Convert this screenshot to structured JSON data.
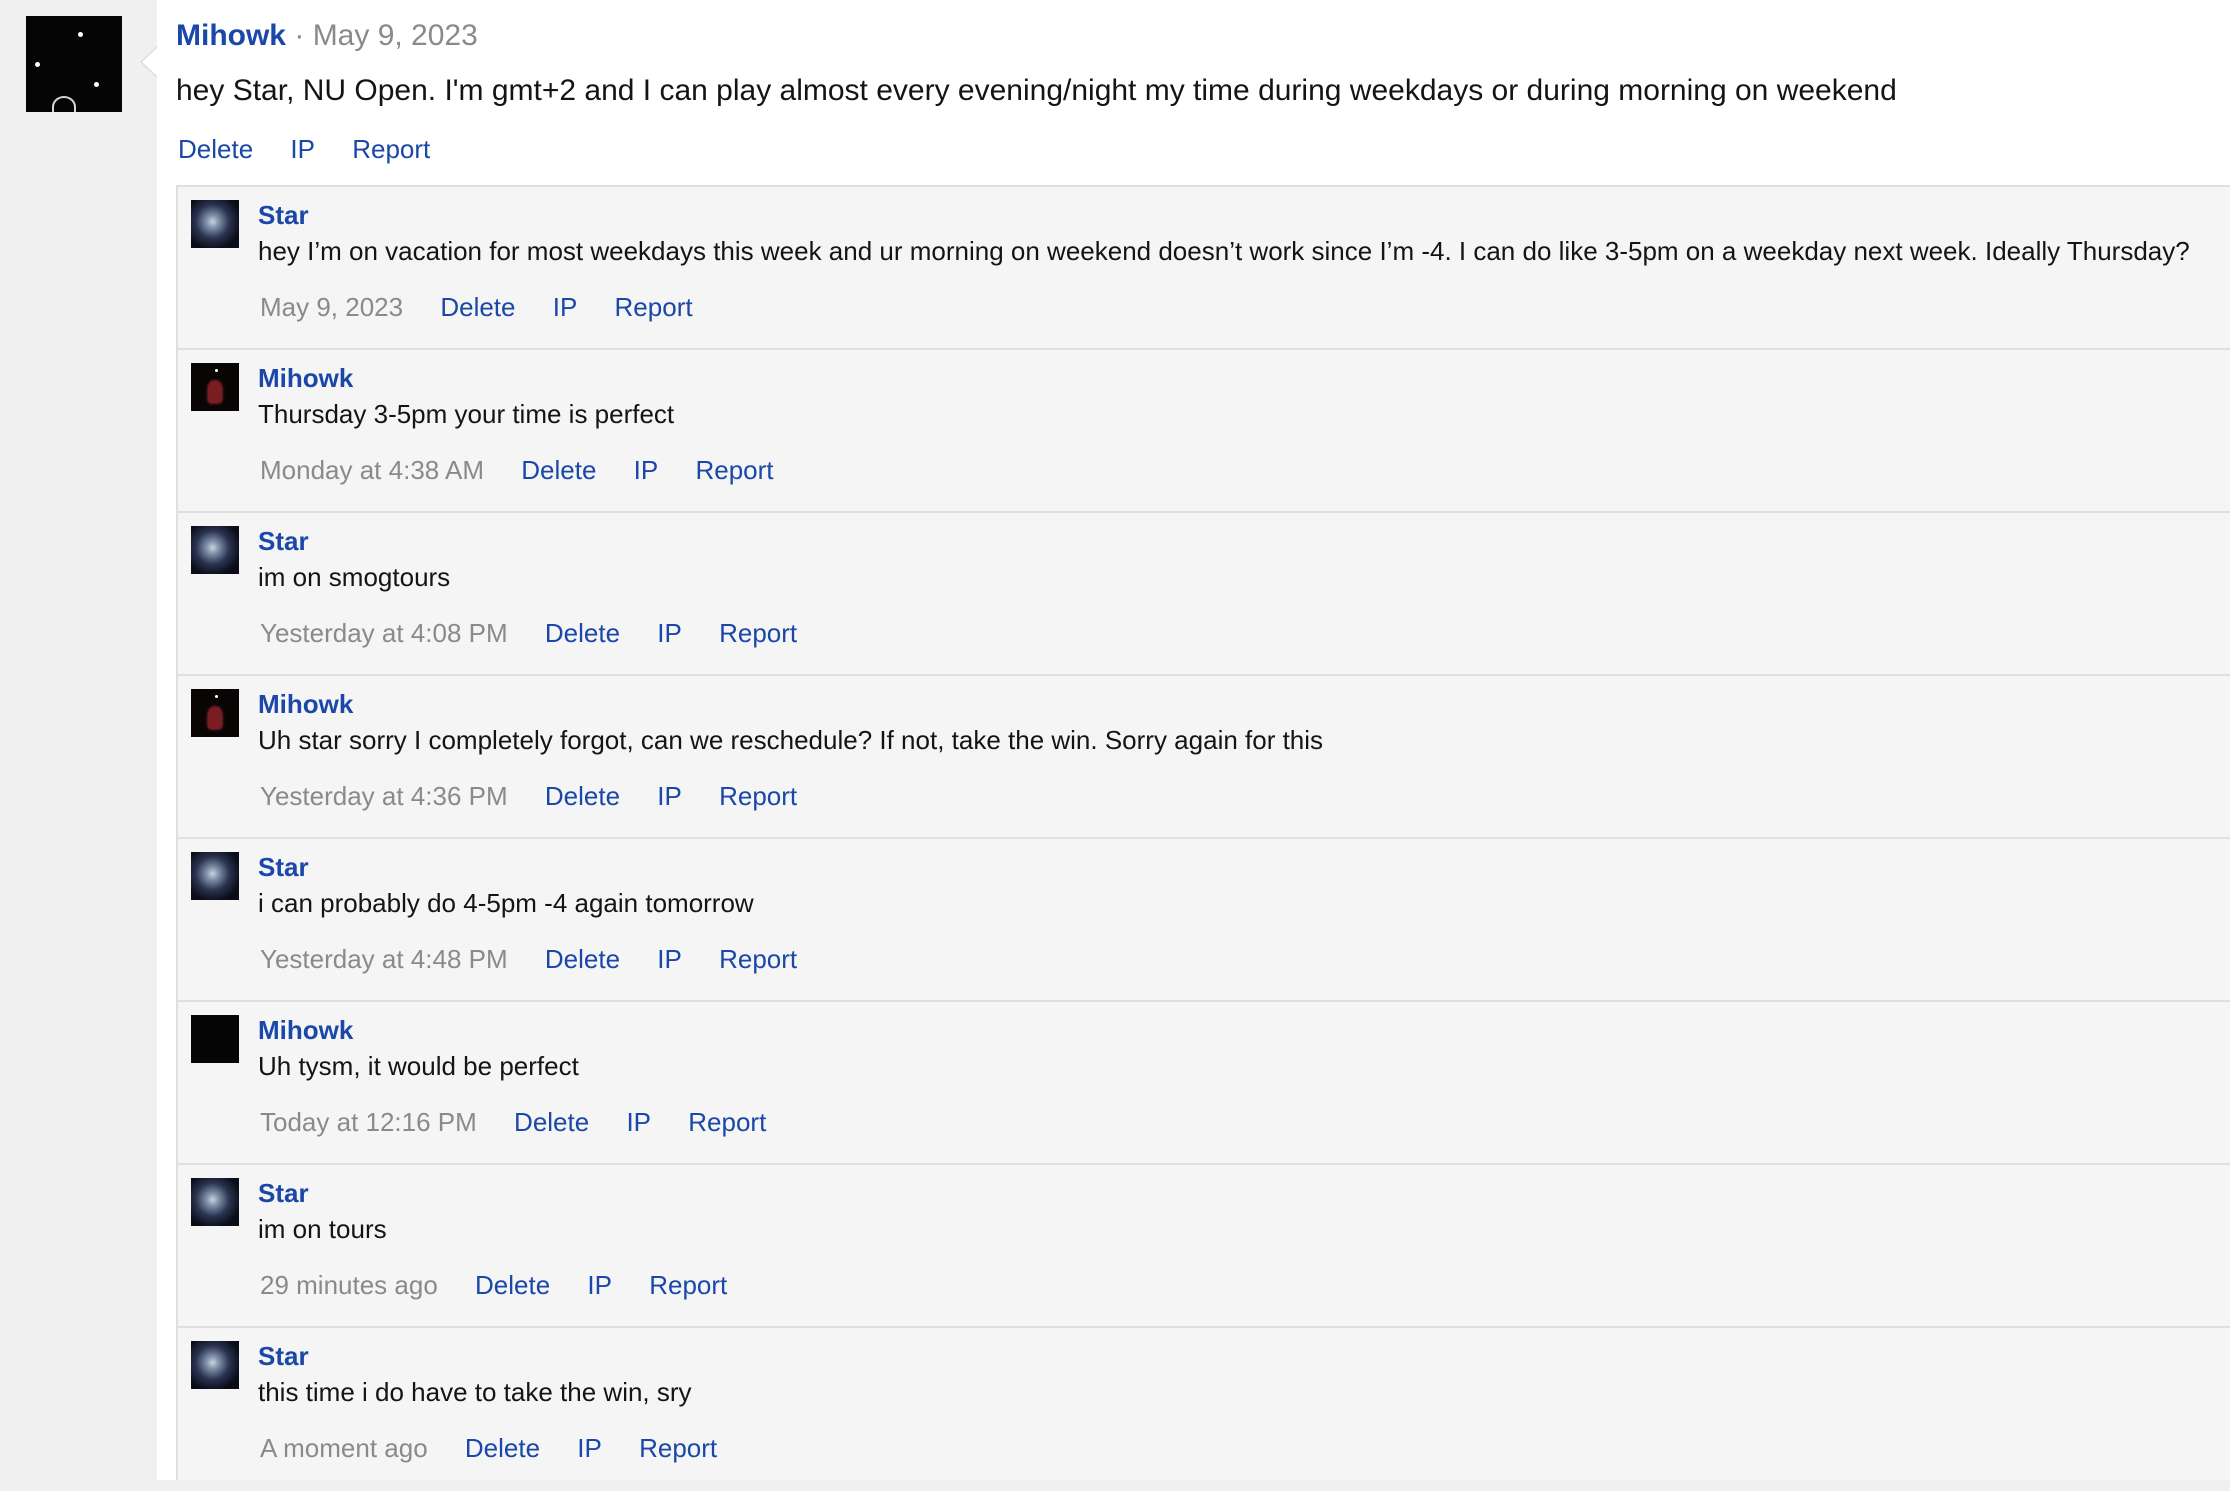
{
  "post": {
    "username": "Mihowk",
    "separator": "·",
    "date": "May 9, 2023",
    "body": "hey Star, NU Open. I'm gmt+2 and I can play almost every evening/night my time during weekdays or during morning on weekend",
    "actions": {
      "delete": "Delete",
      "ip": "IP",
      "report": "Report"
    }
  },
  "comments": [
    {
      "username": "Star",
      "avatar": "star",
      "text": "hey I’m on vacation for most weekdays this week and ur morning on weekend doesn’t work since I’m -4. I can do like 3-5pm on a weekday next week. Ideally Thursday?",
      "time": "May 9, 2023",
      "delete": "Delete",
      "ip": "IP",
      "report": "Report"
    },
    {
      "username": "Mihowk",
      "avatar": "mihowk",
      "text": "Thursday 3-5pm your time is perfect",
      "time": "Monday at 4:38 AM",
      "delete": "Delete",
      "ip": "IP",
      "report": "Report"
    },
    {
      "username": "Star",
      "avatar": "star",
      "text": "im on smogtours",
      "time": "Yesterday at 4:08 PM",
      "delete": "Delete",
      "ip": "IP",
      "report": "Report"
    },
    {
      "username": "Mihowk",
      "avatar": "mihowk",
      "text": "Uh star sorry I completely forgot, can we reschedule? If not, take the win. Sorry again for this",
      "time": "Yesterday at 4:36 PM",
      "delete": "Delete",
      "ip": "IP",
      "report": "Report"
    },
    {
      "username": "Star",
      "avatar": "star",
      "text": "i can probably do 4-5pm -4 again tomorrow",
      "time": "Yesterday at 4:48 PM",
      "delete": "Delete",
      "ip": "IP",
      "report": "Report"
    },
    {
      "username": "Mihowk",
      "avatar": "dark",
      "text": "Uh tysm, it would be perfect",
      "time": "Today at 12:16 PM",
      "delete": "Delete",
      "ip": "IP",
      "report": "Report"
    },
    {
      "username": "Star",
      "avatar": "star",
      "text": "im on tours",
      "time": "29 minutes ago",
      "delete": "Delete",
      "ip": "IP",
      "report": "Report"
    },
    {
      "username": "Star",
      "avatar": "star",
      "text": "this time i do have to take the win, sry",
      "time": "A moment ago",
      "delete": "Delete",
      "ip": "IP",
      "report": "Report"
    }
  ]
}
